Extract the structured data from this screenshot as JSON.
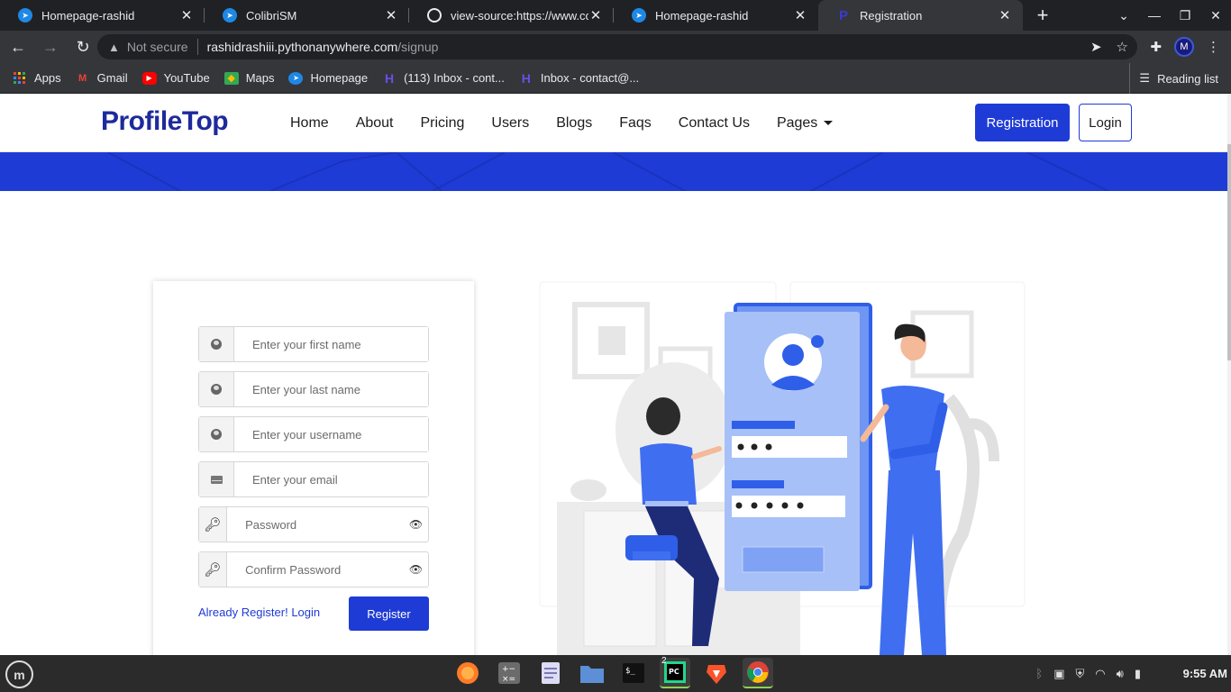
{
  "browser": {
    "tabs": [
      {
        "title": "Homepage-rashid",
        "icon": "colibri-icon"
      },
      {
        "title": "ColibriSM",
        "icon": "colibri-icon"
      },
      {
        "title": "view-source:https://www.co",
        "icon": "globe-icon"
      },
      {
        "title": "Homepage-rashid",
        "icon": "colibri-icon"
      },
      {
        "title": "Registration",
        "icon": "profiletop-icon",
        "active": true
      }
    ],
    "address": {
      "security_label": "Not secure",
      "host": "rashidrashiii.pythonanywhere.com",
      "path": "/signup"
    },
    "profile_initial": "M",
    "bookmarks": [
      {
        "label": "Apps",
        "icon": "apps-grid-icon"
      },
      {
        "label": "Gmail",
        "icon": "gmail-icon"
      },
      {
        "label": "YouTube",
        "icon": "youtube-icon"
      },
      {
        "label": "Maps",
        "icon": "maps-icon"
      },
      {
        "label": "Homepage",
        "icon": "colibri-icon"
      },
      {
        "label": "(113) Inbox - cont...",
        "icon": "hostinger-icon"
      },
      {
        "label": "Inbox - contact@...",
        "icon": "hostinger-icon"
      }
    ],
    "reading_list": "Reading list"
  },
  "site": {
    "logo": "ProfileTop",
    "nav": [
      "Home",
      "About",
      "Pricing",
      "Users",
      "Blogs",
      "Faqs",
      "Contact Us",
      "Pages"
    ],
    "registration_button": "Registration",
    "login_button": "Login",
    "brand_color": "#1f3bd6"
  },
  "form": {
    "fields": {
      "first_name": {
        "placeholder": "Enter your first name",
        "value": ""
      },
      "last_name": {
        "placeholder": "Enter your last name",
        "value": ""
      },
      "username": {
        "placeholder": "Enter your username",
        "value": ""
      },
      "email": {
        "placeholder": "Enter your email",
        "value": ""
      },
      "password": {
        "placeholder": "Password",
        "value": ""
      },
      "confirm_password": {
        "placeholder": "Confirm Password",
        "value": ""
      }
    },
    "login_link": "Already Register! Login",
    "submit": "Register"
  },
  "taskbar": {
    "clock": "9:55 AM",
    "pycharm_badge": "2",
    "apps": [
      "firefox-icon",
      "calculator-icon",
      "text-editor-icon",
      "files-icon",
      "terminal-icon",
      "pycharm-icon",
      "brave-icon",
      "chrome-icon"
    ]
  }
}
